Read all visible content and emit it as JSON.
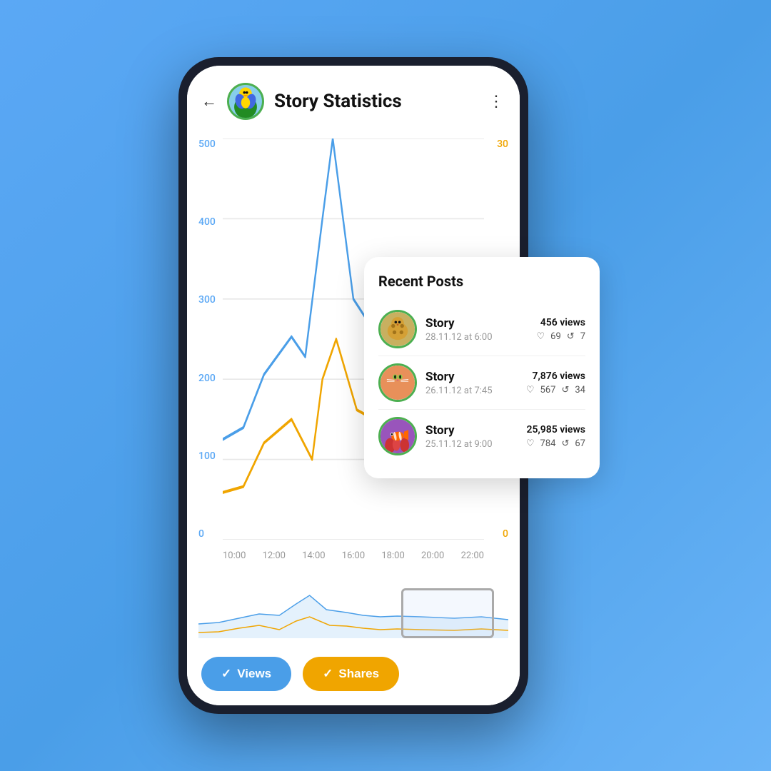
{
  "header": {
    "back_label": "←",
    "title": "Story Statistics",
    "more_label": "⋮"
  },
  "chart": {
    "y_axis_left": [
      "500",
      "400",
      "300",
      "200",
      "100",
      "0"
    ],
    "y_axis_right": [
      "30",
      "",
      "",
      "",
      "",
      "0"
    ],
    "x_axis": [
      "10:00",
      "12:00",
      "14:00",
      "16:00",
      "18:00",
      "20:00",
      "22:00"
    ]
  },
  "buttons": {
    "views_label": "Views",
    "shares_label": "Shares",
    "check": "✓"
  },
  "recent_posts": {
    "title": "Recent Posts",
    "posts": [
      {
        "name": "Story",
        "date": "28.11.12 at 6:00",
        "views": "456 views",
        "likes": "69",
        "shares": "7",
        "thumb_color": "#c8a060",
        "thumb_type": "leopard"
      },
      {
        "name": "Story",
        "date": "26.11.12 at 7:45",
        "views": "7,876 views",
        "likes": "567",
        "shares": "34",
        "thumb_color": "#e8905a",
        "thumb_type": "cat"
      },
      {
        "name": "Story",
        "date": "25.11.12 at 9:00",
        "views": "25,985 views",
        "likes": "784",
        "shares": "67",
        "thumb_color": "#e06020",
        "thumb_type": "fish"
      }
    ]
  }
}
